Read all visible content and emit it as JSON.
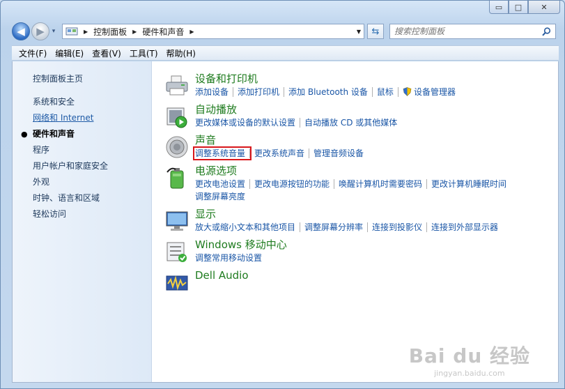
{
  "window": {
    "minimize": "▭",
    "maximize": "□",
    "close": "✕"
  },
  "nav": {
    "back": "◀",
    "forward": "▶",
    "recent": "▾"
  },
  "address": {
    "crumbs": [
      "控制面板",
      "硬件和声音"
    ]
  },
  "search": {
    "placeholder": "搜索控制面板"
  },
  "menu": [
    "文件(F)",
    "编辑(E)",
    "查看(V)",
    "工具(T)",
    "帮助(H)"
  ],
  "sidebar": {
    "items": [
      {
        "label": "控制面板主页"
      },
      {
        "label": "系统和安全"
      },
      {
        "label": "网络和 Internet"
      },
      {
        "label": "硬件和声音"
      },
      {
        "label": "程序"
      },
      {
        "label": "用户帐户和家庭安全"
      },
      {
        "label": "外观"
      },
      {
        "label": "时钟、语言和区域"
      },
      {
        "label": "轻松访问"
      }
    ]
  },
  "categories": [
    {
      "title": "设备和打印机",
      "icon": "printer-icon",
      "links": [
        "添加设备",
        "添加打印机",
        "添加 Bluetooth 设备",
        "鼠标",
        "设备管理器"
      ]
    },
    {
      "title": "自动播放",
      "icon": "autoplay-icon",
      "links": [
        "更改媒体或设备的默认设置",
        "自动播放 CD 或其他媒体"
      ]
    },
    {
      "title": "声音",
      "icon": "speaker-icon",
      "links": [
        "调整系统音量",
        "更改系统声音",
        "管理音频设备"
      ]
    },
    {
      "title": "电源选项",
      "icon": "battery-icon",
      "links": [
        "更改电池设置",
        "更改电源按钮的功能",
        "唤醒计算机时需要密码",
        "更改计算机睡眠时间",
        "调整屏幕亮度"
      ]
    },
    {
      "title": "显示",
      "icon": "monitor-icon",
      "links": [
        "放大或缩小文本和其他项目",
        "调整屏幕分辨率",
        "连接到投影仪",
        "连接到外部显示器"
      ]
    },
    {
      "title": "Windows 移动中心",
      "icon": "mobility-center-icon",
      "links": [
        "调整常用移动设置"
      ]
    },
    {
      "title": "Dell Audio",
      "icon": "dell-audio-icon",
      "links": []
    }
  ],
  "watermark": {
    "brand": "Bai du 经验",
    "site": "jingyan.baidu.com"
  }
}
